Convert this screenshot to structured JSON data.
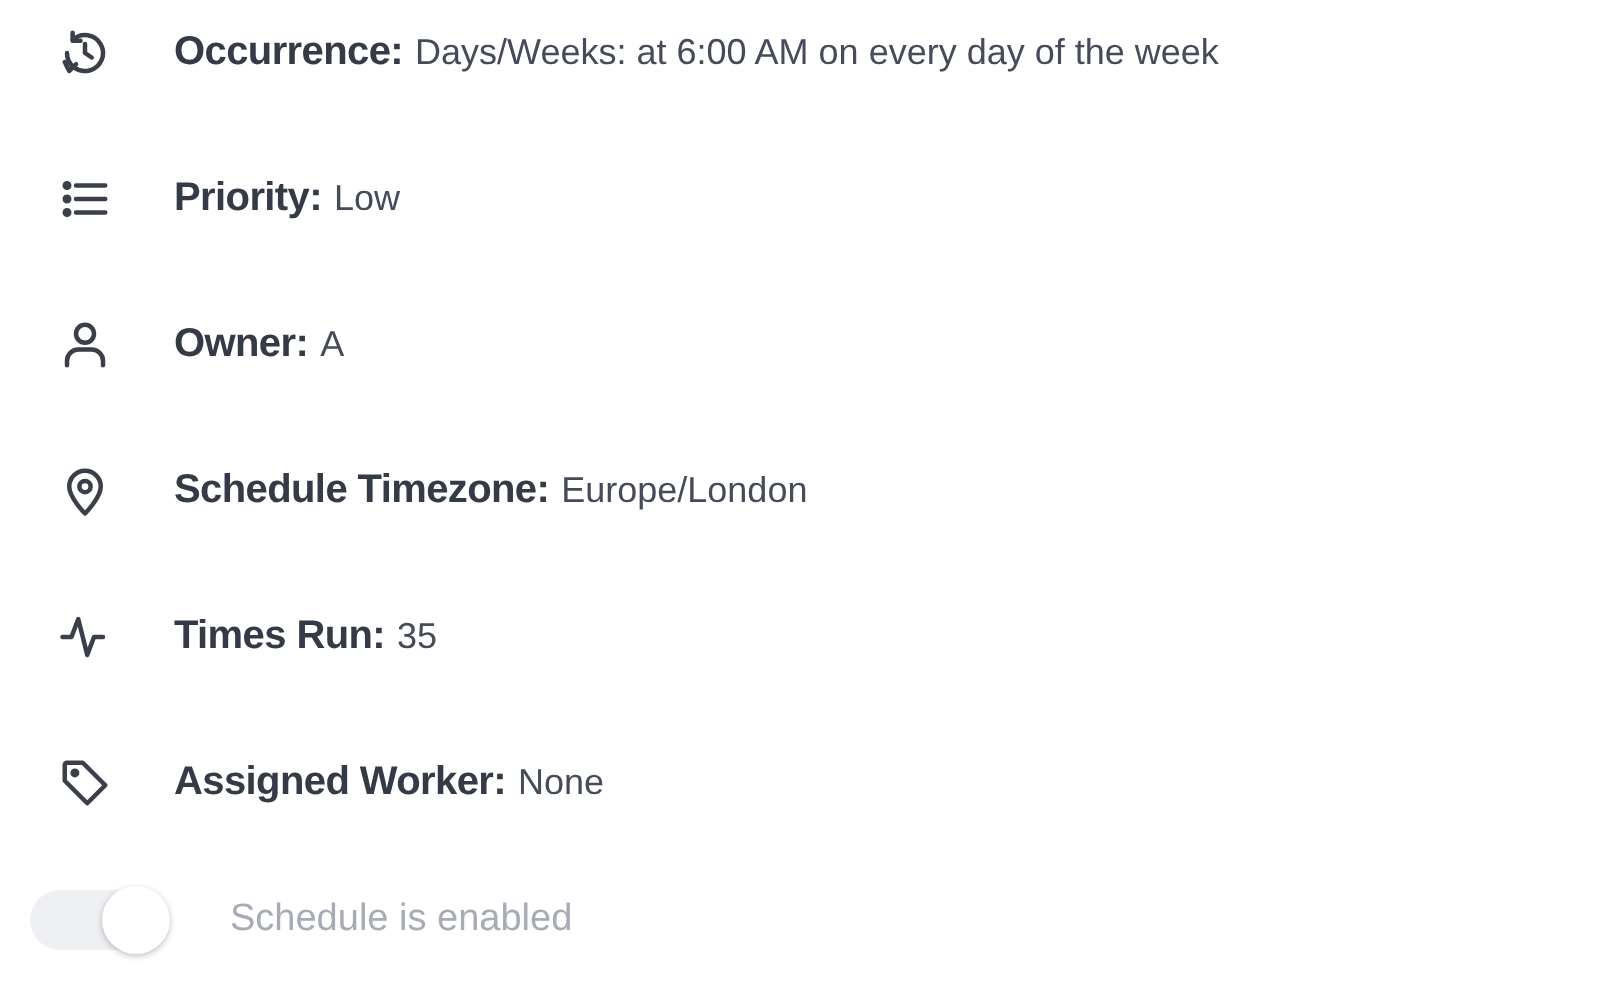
{
  "details": [
    {
      "label": "Occurrence:",
      "value": "Days/Weeks: at 6:00 AM on every day of the week"
    },
    {
      "label": "Priority:",
      "value": "Low"
    },
    {
      "label": "Owner:",
      "value": "A"
    },
    {
      "label": "Schedule Timezone:",
      "value": "Europe/London"
    },
    {
      "label": "Times Run:",
      "value": "35"
    },
    {
      "label": "Assigned Worker:",
      "value": "None"
    }
  ],
  "schedule_toggle": {
    "label": "Schedule is enabled",
    "on": true,
    "disabled": true
  }
}
